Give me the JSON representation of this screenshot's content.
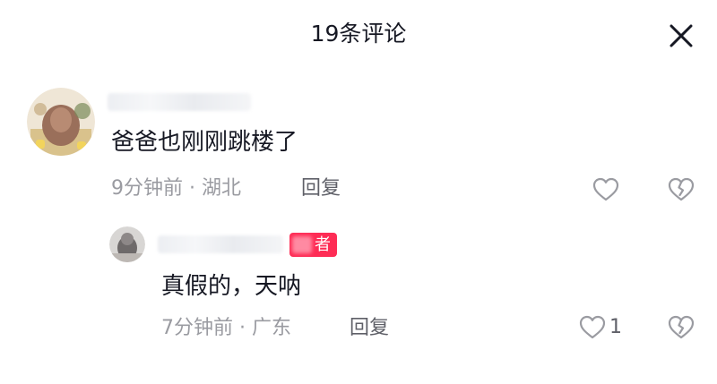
{
  "header": {
    "title": "19条评论"
  },
  "comments": [
    {
      "text": "爸爸也刚刚跳楼了",
      "meta": "9分钟前 · 湖北",
      "reply_label": "回复"
    }
  ],
  "replies": [
    {
      "badge": "者",
      "text": "真假的，天呐",
      "meta": "7分钟前 · 广东",
      "reply_label": "回复",
      "like_count": "1"
    }
  ],
  "colors": {
    "badge": "#fe2c55",
    "meta_text": "#9a9ba1",
    "icon": "#9a9ba1"
  }
}
